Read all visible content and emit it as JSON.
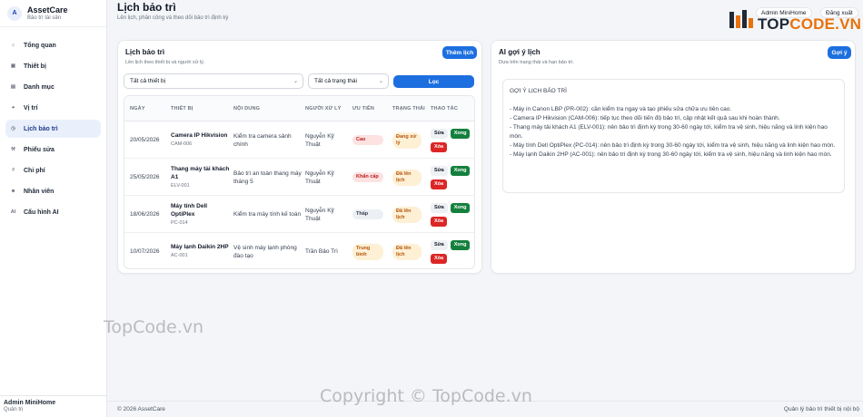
{
  "brand": {
    "initial": "A",
    "name": "AssetCare",
    "subtitle": "Bảo trì tài sản"
  },
  "sidebar": {
    "items": [
      {
        "icon": "⌂",
        "label": "Tổng quan"
      },
      {
        "icon": "▣",
        "label": "Thiết bị"
      },
      {
        "icon": "▤",
        "label": "Danh mục"
      },
      {
        "icon": "⌖",
        "label": "Vị trí"
      },
      {
        "icon": "◷",
        "label": "Lịch bảo trì"
      },
      {
        "icon": "⚒",
        "label": "Phiếu sửa"
      },
      {
        "icon": "₫",
        "label": "Chi phí"
      },
      {
        "icon": "☻",
        "label": "Nhân viên"
      },
      {
        "icon": "AI",
        "label": "Cấu hình AI"
      }
    ],
    "active_index": 4,
    "user": {
      "name": "Admin MiniHome",
      "role": "Quản trị"
    }
  },
  "header": {
    "title": "Lịch bảo trì",
    "subtitle": "Lên lịch, phân công và theo dõi bảo trì định kỳ",
    "user_chip": "Admin MiniHome",
    "logout": "Đăng xuất"
  },
  "schedule": {
    "title": "Lịch bảo trì",
    "subtitle": "Lên lịch theo thiết bị và người xử lý.",
    "add_button": "Thêm lịch",
    "device_filter": "Tất cả thiết bị",
    "status_filter": "Tất cả trạng thái",
    "filter_button": "Lọc",
    "columns": [
      "NGÀY",
      "THIẾT BỊ",
      "NỘI DUNG",
      "NGƯỜI XỬ LÝ",
      "ƯU TIÊN",
      "TRẠNG THÁI",
      "THAO TÁC"
    ],
    "rows": [
      {
        "date": "20/05/2026",
        "device": "Camera IP Hikvision",
        "code": "CAM-006",
        "content": "Kiểm tra camera sảnh chính",
        "assignee": "Nguyễn Kỹ Thuật",
        "priority": "Cao",
        "status": "Đang xử lý"
      },
      {
        "date": "25/05/2026",
        "device": "Thang máy tải khách A1",
        "code": "ELV-001",
        "content": "Bảo trì an toàn thang máy tháng 5",
        "assignee": "Nguyễn Kỹ Thuật",
        "priority": "Khẩn cấp",
        "status": "Đã lên lịch"
      },
      {
        "date": "18/06/2026",
        "device": "Máy tính Dell OptiPlex",
        "code": "PC-014",
        "content": "Kiểm tra máy tính kế toán",
        "assignee": "Nguyễn Kỹ Thuật",
        "priority": "Thấp",
        "status": "Đã lên lịch"
      },
      {
        "date": "10/07/2026",
        "device": "Máy lạnh Daikin 2HP",
        "code": "AC-001",
        "content": "Vệ sinh máy lạnh phòng đào tạo",
        "assignee": "Trần Bảo Trì",
        "priority": "Trung bình",
        "status": "Đã lên lịch"
      }
    ],
    "actions": {
      "edit": "Sửa",
      "done": "Xong",
      "delete": "Xóa"
    }
  },
  "ai": {
    "title": "AI gợi ý lịch",
    "subtitle": "Dựa trên trạng thái và hạn bảo trì.",
    "button": "Gợi ý",
    "heading": "GỢI Ý LỊCH BẢO TRÌ",
    "lines": [
      "- Máy in Canon LBP (PR-002): cần kiểm tra ngay và tạo phiếu sửa chữa ưu tiên cao.",
      "- Camera IP Hikvision (CAM-006): tiếp tục theo dõi tiến độ bảo trì, cập nhật kết quả sau khi hoàn thành.",
      "- Thang máy tải khách A1 (ELV-001): nên bảo trì định kỳ trong 30-60 ngày tới, kiểm tra vệ sinh, hiệu năng và linh kiện hao mòn.",
      "- Máy tính Dell OptiPlex (PC-014): nên bảo trì định kỳ trong 30-60 ngày tới, kiểm tra vệ sinh, hiệu năng và linh kiện hao mòn.",
      "- Máy lạnh Daikin 2HP (AC-001): nên bảo trì định kỳ trong 30-60 ngày tới, kiểm tra vệ sinh, hiệu năng và linh kiện hao mòn."
    ]
  },
  "footer": {
    "copyright": "© 2026 AssetCare",
    "tagline": "Quản lý bảo trì thiết bị nội bộ"
  },
  "overlay": {
    "logo_a": "TOP",
    "logo_b": "CODE.VN",
    "wm1": "TopCode.vn",
    "wm2": "Copyright © TopCode.vn"
  },
  "colors": {
    "priority": {
      "Cao": [
        "#fde2e2",
        "#b91c1c"
      ],
      "Khẩn cấp": [
        "#fde2e2",
        "#b91c1c"
      ],
      "Thấp": [
        "#eceff3",
        "#374151"
      ],
      "Trung bình": [
        "#fdf0d5",
        "#b45309"
      ]
    },
    "status": {
      "Đang xử lý": [
        "#fdf0d5",
        "#b45309"
      ],
      "Đã lên lịch": [
        "#fdf0d5",
        "#b45309"
      ]
    }
  }
}
